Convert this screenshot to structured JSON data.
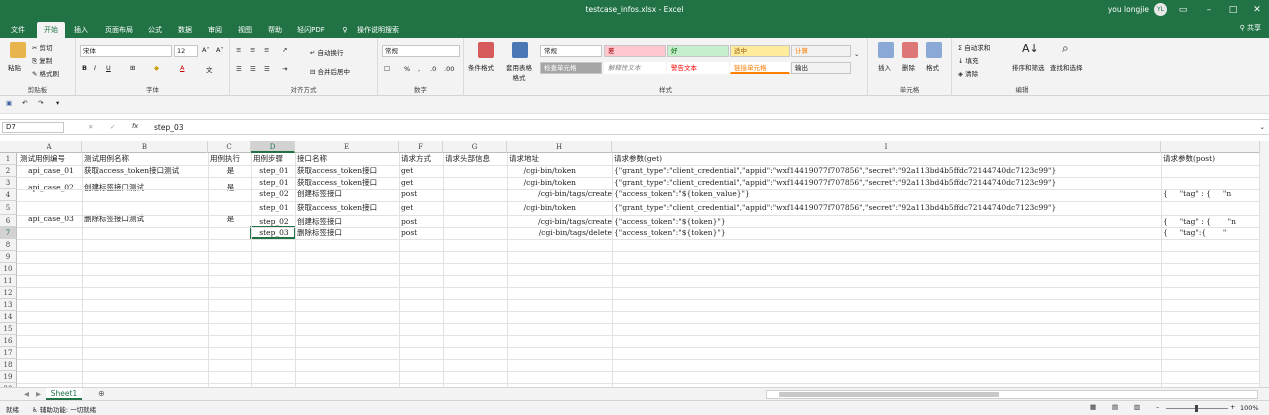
{
  "titlebar": {
    "title": "testcase_infos.xlsx  -  Excel",
    "user": "you longjie",
    "avatar": "YL"
  },
  "tabs": [
    "文件",
    "开始",
    "插入",
    "页面布局",
    "公式",
    "数据",
    "审阅",
    "视图",
    "帮助",
    "轻闪PDF",
    "操作说明搜索"
  ],
  "share_label": "共享",
  "ribbon": {
    "clipboard": {
      "paste": "粘贴",
      "cut": "剪切",
      "copy": "复制",
      "format_painter": "格式刷",
      "label": "剪贴板"
    },
    "font": {
      "name": "宋体",
      "size": "12",
      "label": "字体"
    },
    "align": {
      "wrap": "自动换行",
      "merge": "合并后居中",
      "label": "对齐方式"
    },
    "number": {
      "format": "常规",
      "label": "数字"
    },
    "styles": {
      "conditional": "条件格式",
      "table": "套用表格格式",
      "items": [
        "常规",
        "差",
        "好",
        "适中",
        "计算",
        "检查单元格",
        "解释性文本",
        "警告文本",
        "链接单元格",
        "输出"
      ],
      "label": "样式"
    },
    "cells": {
      "insert": "插入",
      "delete": "删除",
      "format": "格式",
      "label": "单元格"
    },
    "editing": {
      "autosum": "自动求和",
      "fill": "填充",
      "clear": "清除",
      "sort": "排序和筛选",
      "find": "查找和选择",
      "label": "编辑"
    }
  },
  "formula_bar": {
    "name_box": "D7",
    "fx": "fx",
    "content": "step_03"
  },
  "columns": [
    "A",
    "B",
    "C",
    "D",
    "E",
    "F",
    "G",
    "H",
    "I"
  ],
  "rows": [
    "1",
    "2",
    "3",
    "4",
    "5",
    "6",
    "7",
    "8",
    "9",
    "10",
    "11",
    "12",
    "13",
    "14",
    "15",
    "16",
    "17",
    "18",
    "19",
    "20"
  ],
  "cells": {
    "headers": [
      "测试用例编号",
      "测试用例名称",
      "用例执行",
      "用例步骤",
      "接口名称",
      "请求方式",
      "请求头部信息",
      "请求地址",
      "请求参数(get)",
      "请求参数(post)"
    ],
    "case1": {
      "id": "api_case_01",
      "name": "获取access_token接口测试",
      "exec": "是",
      "step": "step_01",
      "iface": "获取access_token接口",
      "method": "get",
      "url": "/cgi-bin/token",
      "param": "{\"grant_type\":\"client_credential\",\"appid\":\"wxf14419077f707856\",\"secret\":\"92a113bd4b5ffdc72144740dc7123c99\"}"
    },
    "case2": {
      "id": "api_case_02",
      "name": "创建标签接口测试",
      "exec": "是",
      "step1": "step_01",
      "iface1": "获取access_token接口",
      "method1": "get",
      "url1": "/cgi-bin/token",
      "param1": "{\"grant_type\":\"client_credential\",\"appid\":\"wxf14419077f707856\",\"secret\":\"92a113bd4b5ffdc72144740dc7123c99\"}",
      "step2": "step_02",
      "iface2": "创建标签接口",
      "method2": "post",
      "url2": "/cgi-bin/tags/create",
      "param2": "{\"access_token\":\"${token_value}\"}",
      "post2": "{     \"tag\" : {     \"n"
    },
    "case3": {
      "id": "api_case_03",
      "name": "删除标签接口测试",
      "exec": "是",
      "step1": "step_01",
      "iface1": "获取access_token接口",
      "method1": "get",
      "url1": "/cgi-bin/token",
      "param1": "{\"grant_type\":\"client_credential\",\"appid\":\"wxf14419077f707856\",\"secret\":\"92a113bd4b5ffdc72144740dc7123c99\"}",
      "step2": "step_02",
      "iface2": "创建标签接口",
      "method2": "post",
      "url2": "/cgi-bin/tags/create",
      "param2": "{\"access_token\":\"${token}\"}",
      "post2": "{     \"tag\" : {       \"n",
      "step3": "step_03",
      "iface3": "删除标签接口",
      "method3": "post",
      "url3": "/cgi-bin/tags/delete",
      "param3": "{\"access_token\":\"${token}\"}",
      "post3": "{     \"tag\":{       \""
    }
  },
  "sheet_tab": "Sheet1",
  "status": {
    "ready": "就绪",
    "accessibility": "辅助功能: 一切就绪",
    "zoom": "100%"
  },
  "colors": {
    "accent": "#217346",
    "bad": "#ffc7ce",
    "good": "#c6efce",
    "neutral": "#ffeb9c"
  }
}
